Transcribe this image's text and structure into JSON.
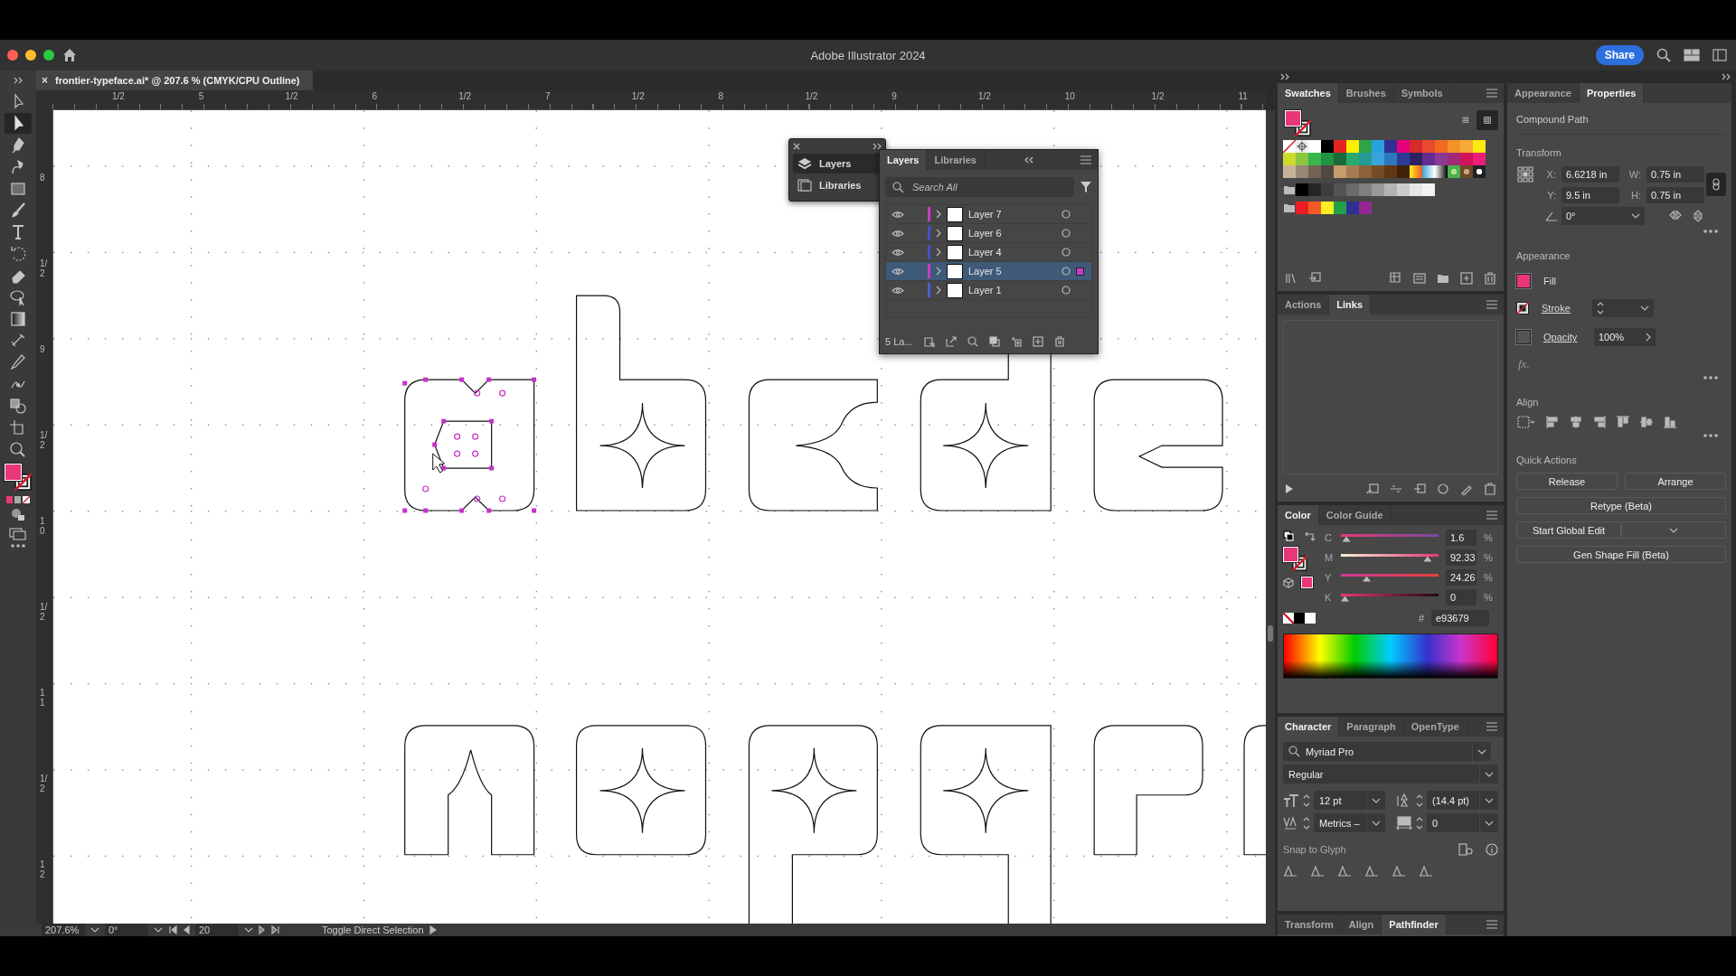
{
  "window": {
    "title": "Adobe Illustrator 2024",
    "share_button": "Share"
  },
  "document_tab": {
    "close": "×",
    "title": "frontier-typeface.ai* @ 207.6 % (CMYK/CPU Outline)"
  },
  "tools": [
    {
      "kind": "select",
      "selected": false
    },
    {
      "kind": "direct-select",
      "selected": true
    },
    {
      "kind": "pen",
      "selected": false
    },
    {
      "kind": "curvature",
      "selected": false
    },
    {
      "kind": "rectangle",
      "selected": false
    },
    {
      "kind": "brush",
      "selected": false
    },
    {
      "kind": "type",
      "selected": false
    },
    {
      "kind": "rotate",
      "selected": false
    },
    {
      "kind": "eraser",
      "selected": false
    },
    {
      "kind": "lasso",
      "selected": false
    },
    {
      "kind": "gradient",
      "selected": false
    },
    {
      "kind": "width",
      "selected": false
    },
    {
      "kind": "eyedropper",
      "selected": false
    },
    {
      "kind": "puppet",
      "selected": false
    },
    {
      "kind": "shape-builder",
      "selected": false
    },
    {
      "kind": "artboard",
      "selected": false
    },
    {
      "kind": "zoom",
      "selected": false
    }
  ],
  "horizontal_ruler": {
    "labels": [
      "1/2",
      "5",
      "1/2",
      "6",
      "1/2",
      "7",
      "1/2",
      "8",
      "1/2",
      "9",
      "1/2",
      "10",
      "1/2",
      "11"
    ]
  },
  "vertical_ruler": {
    "labels": [
      "8",
      "1/2",
      "9",
      "1/2",
      "10",
      "1/2",
      "11",
      "1/2",
      "12"
    ]
  },
  "layers_dock": {
    "items": [
      {
        "label": "Layers",
        "selected": true
      },
      {
        "label": "Libraries",
        "selected": false
      }
    ]
  },
  "layers_panel": {
    "tabs": [
      {
        "label": "Layers",
        "selected": true
      },
      {
        "label": "Libraries",
        "selected": false
      }
    ],
    "search": {
      "placeholder": "Search All"
    },
    "layers": [
      {
        "name": "Layer 7",
        "color": "#c83cc8",
        "visible": true,
        "selected": false
      },
      {
        "name": "Layer 6",
        "color": "#4450d0",
        "visible": true,
        "selected": false
      },
      {
        "name": "Layer 4",
        "color": "#4450d0",
        "visible": true,
        "selected": false
      },
      {
        "name": "Layer 5",
        "color": "#c83cc8",
        "visible": true,
        "selected": true
      },
      {
        "name": "Layer 1",
        "color": "#4460d0",
        "visible": true,
        "selected": false
      }
    ],
    "footer": "5 La..."
  },
  "swatches_panel": {
    "tabs": [
      {
        "label": "Swatches",
        "selected": true
      },
      {
        "label": "Brushes",
        "selected": false
      },
      {
        "label": "Symbols",
        "selected": false
      }
    ],
    "view_buttons": [
      {
        "kind": "list",
        "selected": false
      },
      {
        "kind": "grid",
        "selected": true
      }
    ],
    "rows": [
      {
        "group": false,
        "swatches": [
          {
            "kind": "none"
          },
          {
            "kind": "registration"
          },
          {
            "kind": "color",
            "color": "#ffffff"
          },
          {
            "kind": "color",
            "color": "#000000"
          },
          {
            "kind": "color",
            "color": "#e52421"
          },
          {
            "kind": "color",
            "color": "#ffed00"
          },
          {
            "kind": "color",
            "color": "#2da448"
          },
          {
            "kind": "color",
            "color": "#2aa2dd"
          },
          {
            "kind": "color",
            "color": "#2e3192"
          },
          {
            "kind": "color",
            "color": "#e6007e"
          },
          {
            "kind": "color",
            "color": "#d62b2b"
          },
          {
            "kind": "color",
            "color": "#e84a2e"
          },
          {
            "kind": "color",
            "color": "#f06a22"
          },
          {
            "kind": "color",
            "color": "#f39325"
          },
          {
            "kind": "color",
            "color": "#f8a93a"
          },
          {
            "kind": "color",
            "color": "#fcea10"
          }
        ]
      },
      {
        "group": false,
        "swatches": [
          {
            "kind": "color",
            "color": "#cbdb2a"
          },
          {
            "kind": "color",
            "color": "#8cc63f"
          },
          {
            "kind": "color",
            "color": "#39b54a"
          },
          {
            "kind": "color",
            "color": "#249143"
          },
          {
            "kind": "color",
            "color": "#1a6b37"
          },
          {
            "kind": "color",
            "color": "#29a96b"
          },
          {
            "kind": "color",
            "color": "#239a96"
          },
          {
            "kind": "color",
            "color": "#3ba3dc"
          },
          {
            "kind": "color",
            "color": "#2e78bf"
          },
          {
            "kind": "color",
            "color": "#2b3d95"
          },
          {
            "kind": "color",
            "color": "#2b2363"
          },
          {
            "kind": "color",
            "color": "#662d91"
          },
          {
            "kind": "color",
            "color": "#8b3a94"
          },
          {
            "kind": "color",
            "color": "#9e2a76"
          },
          {
            "kind": "color",
            "color": "#d4145a"
          },
          {
            "kind": "color",
            "color": "#ed1e79"
          }
        ]
      },
      {
        "group": false,
        "swatches": [
          {
            "kind": "color",
            "color": "#c7b299"
          },
          {
            "kind": "color",
            "color": "#998675"
          },
          {
            "kind": "color",
            "color": "#736357"
          },
          {
            "kind": "color",
            "color": "#534741"
          },
          {
            "kind": "color",
            "color": "#c69c6d"
          },
          {
            "kind": "color",
            "color": "#a67c52"
          },
          {
            "kind": "color",
            "color": "#8c6239"
          },
          {
            "kind": "color",
            "color": "#754c24"
          },
          {
            "kind": "color",
            "color": "#603813"
          },
          {
            "kind": "color",
            "color": "#42210b"
          },
          {
            "kind": "gradient"
          },
          {
            "kind": "gradient"
          },
          {
            "kind": "gradient"
          },
          {
            "kind": "pattern"
          },
          {
            "kind": "pattern"
          },
          {
            "kind": "pattern"
          }
        ]
      },
      {
        "group": true,
        "swatches": [
          {
            "kind": "color",
            "color": "#000000"
          },
          {
            "kind": "color",
            "color": "#262626"
          },
          {
            "kind": "color",
            "color": "#3d3d3d"
          },
          {
            "kind": "color",
            "color": "#545454"
          },
          {
            "kind": "color",
            "color": "#6b6b6b"
          },
          {
            "kind": "color",
            "color": "#808080"
          },
          {
            "kind": "color",
            "color": "#999999"
          },
          {
            "kind": "color",
            "color": "#b3b3b3"
          },
          {
            "kind": "color",
            "color": "#cccccc"
          },
          {
            "kind": "color",
            "color": "#e6e6e6"
          },
          {
            "kind": "color",
            "color": "#f2f2f2"
          }
        ]
      },
      {
        "group": true,
        "swatches": [
          {
            "kind": "color",
            "color": "#ed1c24"
          },
          {
            "kind": "color",
            "color": "#f15a24"
          },
          {
            "kind": "color",
            "color": "#fcee21"
          },
          {
            "kind": "color",
            "color": "#22a04a"
          },
          {
            "kind": "color",
            "color": "#2e3192"
          },
          {
            "kind": "color",
            "color": "#93278f"
          }
        ]
      }
    ]
  },
  "links_panel": {
    "tabs": [
      {
        "label": "Actions",
        "selected": false
      },
      {
        "label": "Links",
        "selected": true
      }
    ]
  },
  "color_panel": {
    "tabs": [
      {
        "label": "Color",
        "selected": true
      },
      {
        "label": "Color Guide",
        "selected": false
      }
    ],
    "channels": [
      {
        "name": "C",
        "level": 0.016,
        "value": "1.6",
        "unit": "%"
      },
      {
        "name": "M",
        "level": 0.9233,
        "value": "92.33",
        "unit": "%"
      },
      {
        "name": "Y",
        "level": 0.2426,
        "value": "24.26",
        "unit": "%"
      },
      {
        "name": "K",
        "level": 0,
        "value": "0",
        "unit": "%"
      }
    ],
    "hex_label": "#",
    "hex": "e93679"
  },
  "character_panel": {
    "tabs": [
      {
        "label": "Character",
        "selected": true
      },
      {
        "label": "Paragraph",
        "selected": false
      },
      {
        "label": "OpenType",
        "selected": false
      }
    ],
    "font_family": "Myriad Pro",
    "font_style": "Regular",
    "font_size": "12 pt",
    "leading": "(14.4 pt)",
    "kerning": "Metrics –",
    "tracking": "0",
    "snap_label": "Snap to Glyph"
  },
  "bottom_tabs": [
    {
      "label": "Transform",
      "selected": false
    },
    {
      "label": "Align",
      "selected": false
    },
    {
      "label": "Pathfinder",
      "selected": true
    }
  ],
  "properties_panel": {
    "tabs": [
      {
        "label": "Appearance",
        "selected": false
      },
      {
        "label": "Properties",
        "selected": true
      }
    ],
    "object_type": "Compound Path",
    "transform": {
      "heading": "Transform",
      "x_label": "X:",
      "x": "6.6218 in",
      "w_label": "W:",
      "w": "0.75 in",
      "y_label": "Y:",
      "y": "9.5 in",
      "h_label": "H:",
      "h": "0.75 in",
      "angle": "0°"
    },
    "appearance": {
      "heading": "Appearance",
      "fill_label": "Fill",
      "stroke_label": "Stroke",
      "opacity_label": "Opacity",
      "opacity": "100%",
      "effects": "fx."
    },
    "align": {
      "heading": "Align"
    },
    "quick_actions": {
      "heading": "Quick Actions",
      "buttons": [
        {
          "label": "Release",
          "dropdown": false
        },
        {
          "label": "Arrange",
          "dropdown": false
        },
        {
          "label": "Retype (Beta)",
          "dropdown": false
        },
        {
          "label": "Start Global Edit",
          "dropdown": true
        },
        {
          "label": "Gen Shape Fill (Beta)",
          "dropdown": false
        }
      ]
    }
  },
  "status_bar": {
    "zoom": "207.6%",
    "rotation": "0°",
    "artboard": "20",
    "tool_hint": "Toggle Direct Selection"
  }
}
